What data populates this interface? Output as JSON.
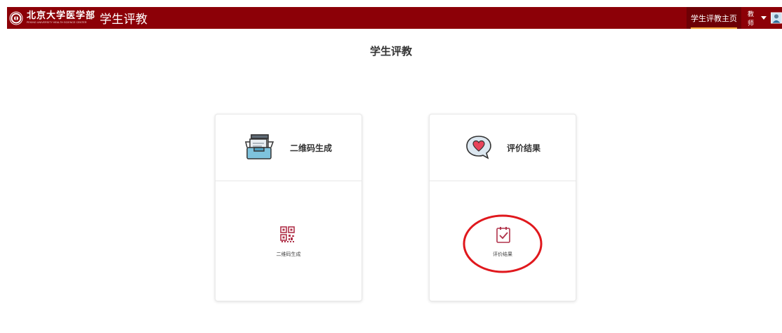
{
  "header": {
    "logo_main": "北京大学医学部",
    "logo_sub": "PEKING UNIVERSITY HEALTH SCIENCE CENTER",
    "app_title": "学生评教",
    "nav_home": "学生评教主页",
    "user_role": "教师",
    "brand_color": "#8c0007"
  },
  "page": {
    "title": "学生评教"
  },
  "cards": [
    {
      "title": "二维码生成",
      "link_label": "二维码生成",
      "header_icon": "inbox-documents-icon",
      "small_icon": "qr-code-icon"
    },
    {
      "title": "评价结果",
      "link_label": "评价结果",
      "header_icon": "heart-speech-bubble-icon",
      "small_icon": "checklist-icon"
    }
  ],
  "annotation": {
    "shape": "red-ellipse-highlight",
    "target": "评价结果",
    "color": "#e0181d"
  }
}
